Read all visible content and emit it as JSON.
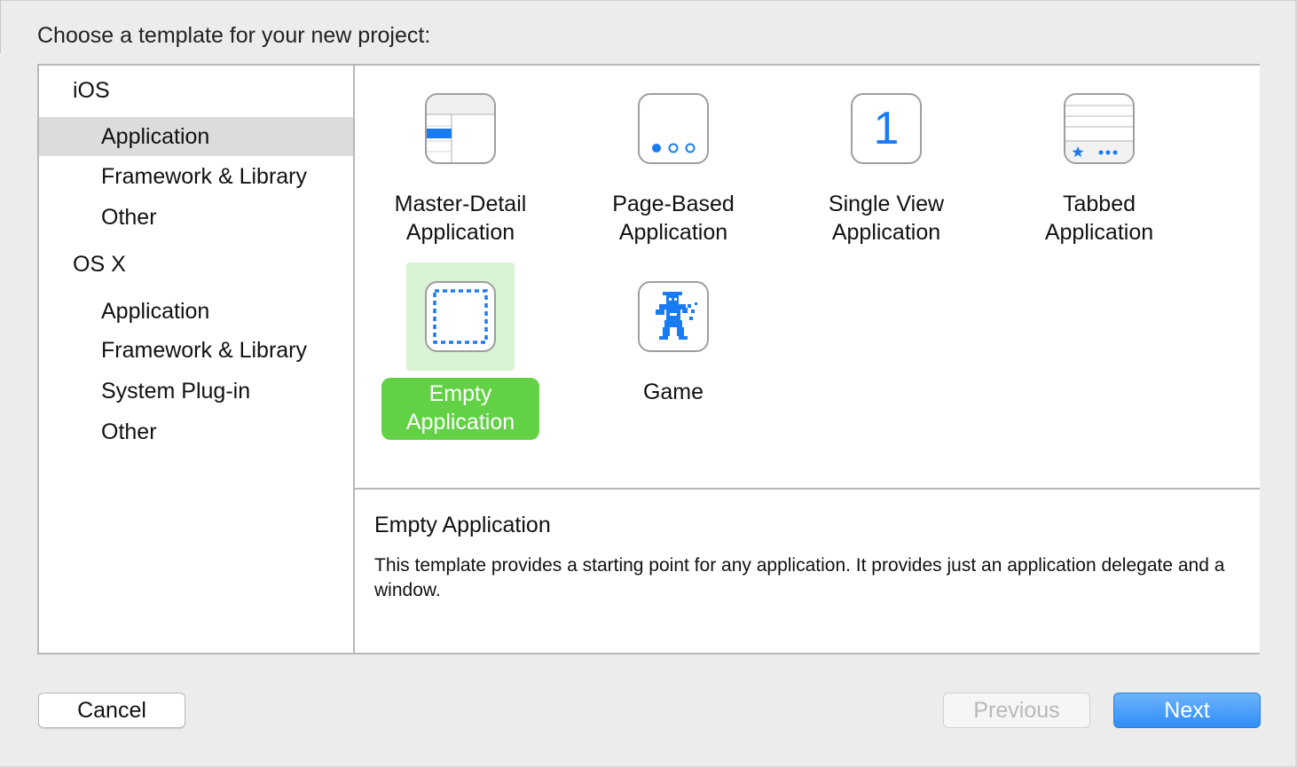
{
  "prompt": "Choose a template for your new project:",
  "sidebar": {
    "groups": [
      {
        "title": "iOS",
        "items": [
          "Application",
          "Framework & Library",
          "Other"
        ]
      },
      {
        "title": "OS X",
        "items": [
          "Application",
          "Framework & Library",
          "System Plug-in",
          "Other"
        ]
      }
    ],
    "selected": "iOS / Application"
  },
  "templates": [
    {
      "line1": "Master-Detail",
      "line2": "Application",
      "icon": "master-detail-icon"
    },
    {
      "line1": "Page-Based",
      "line2": "Application",
      "icon": "page-based-icon"
    },
    {
      "line1": "Single View",
      "line2": "Application",
      "icon": "single-view-icon",
      "glyph": "1"
    },
    {
      "line1": "Tabbed",
      "line2": "Application",
      "icon": "tabbed-icon"
    },
    {
      "line1": "Empty",
      "line2": "Application",
      "icon": "empty-application-icon",
      "selected": true
    },
    {
      "line1": "Game",
      "line2": "",
      "icon": "game-icon"
    }
  ],
  "description": {
    "title": "Empty Application",
    "text": "This template provides a starting point for any application. It provides just an application delegate and a window."
  },
  "buttons": {
    "cancel": "Cancel",
    "previous": "Previous",
    "next": "Next"
  },
  "colors": {
    "accent_blue": "#1a7cf5",
    "selection_green": "#62d146",
    "selection_bg_green": "#d9f2d3"
  }
}
